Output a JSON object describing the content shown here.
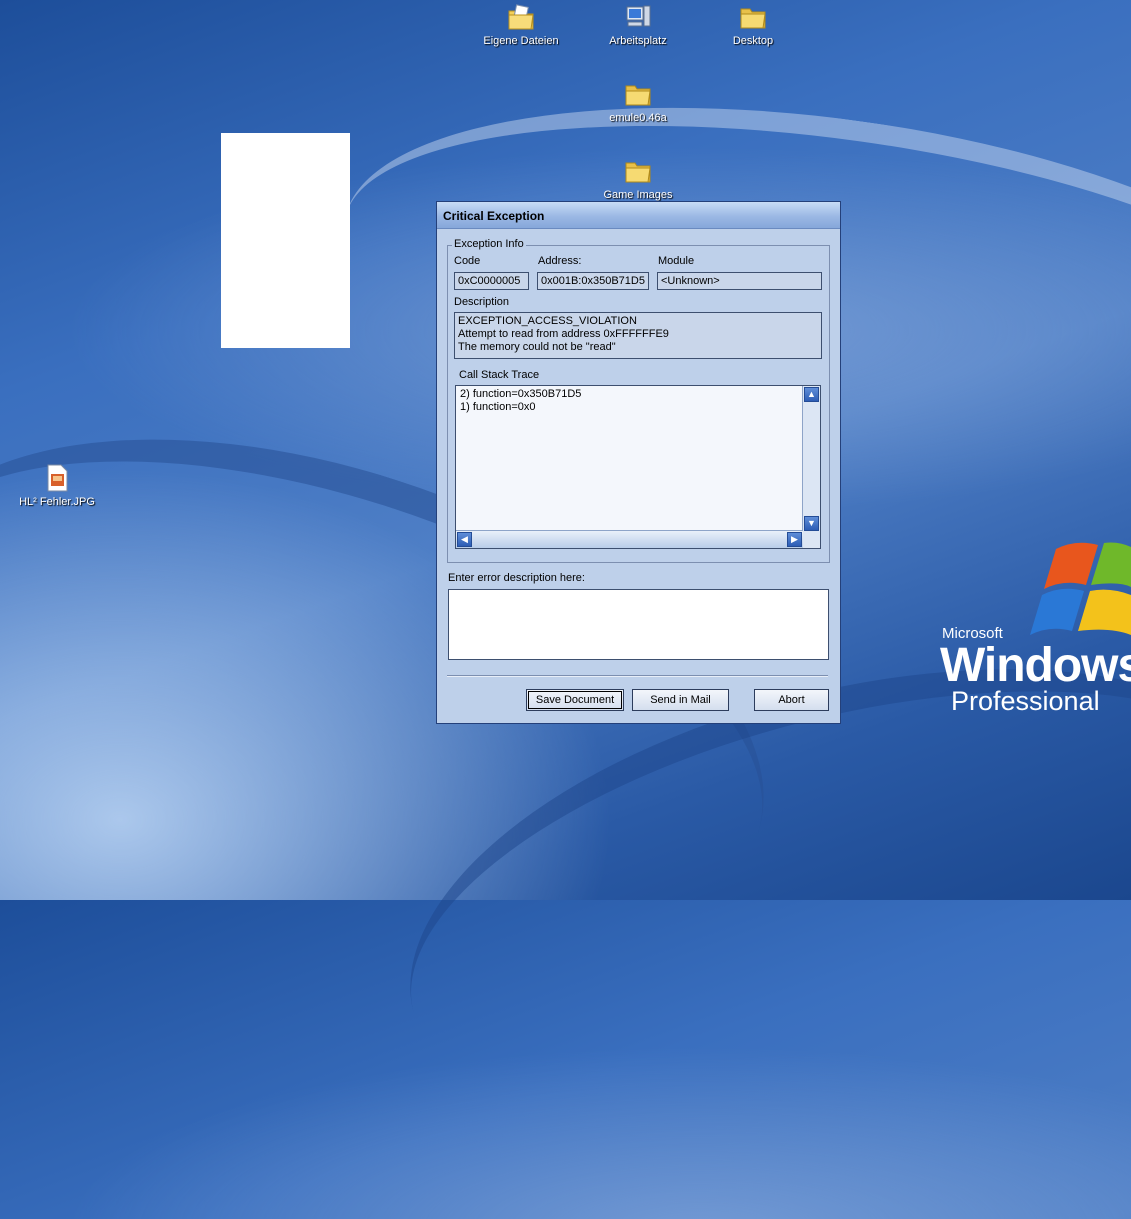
{
  "desktop": {
    "icons": [
      {
        "label": "Eigene Dateien",
        "icon": "my-documents-folder-icon"
      },
      {
        "label": "Arbeitsplatz",
        "icon": "my-computer-icon"
      },
      {
        "label": "Desktop",
        "icon": "folder-icon"
      },
      {
        "label": "emule0.46a",
        "icon": "folder-icon"
      },
      {
        "label": "Game Images",
        "icon": "folder-icon"
      },
      {
        "label": "HL² Fehler.JPG",
        "icon": "jpg-image-file-icon"
      }
    ],
    "wallpaper_logo": {
      "brand": "Microsoft",
      "product": "Windows",
      "edition": "Professional"
    }
  },
  "dialog": {
    "title": "Critical Exception",
    "exception_info": {
      "group_label": "Exception Info",
      "code_label": "Code",
      "code_value": "0xC0000005",
      "address_label": "Address:",
      "address_value": "0x001B:0x350B71D5",
      "module_label": "Module",
      "module_value": "<Unknown>",
      "description_label": "Description",
      "description_lines": [
        "EXCEPTION_ACCESS_VIOLATION",
        "Attempt to read from address 0xFFFFFFE9",
        "The memory could not be \"read\""
      ],
      "stack_label": "Call Stack Trace",
      "stack_lines": [
        "2) function=0x350B71D5",
        "1) function=0x0"
      ]
    },
    "error_description_label": "Enter error description here:",
    "error_description_value": "",
    "buttons": {
      "save": "Save Document",
      "mail": "Send in Mail",
      "abort": "Abort"
    }
  }
}
